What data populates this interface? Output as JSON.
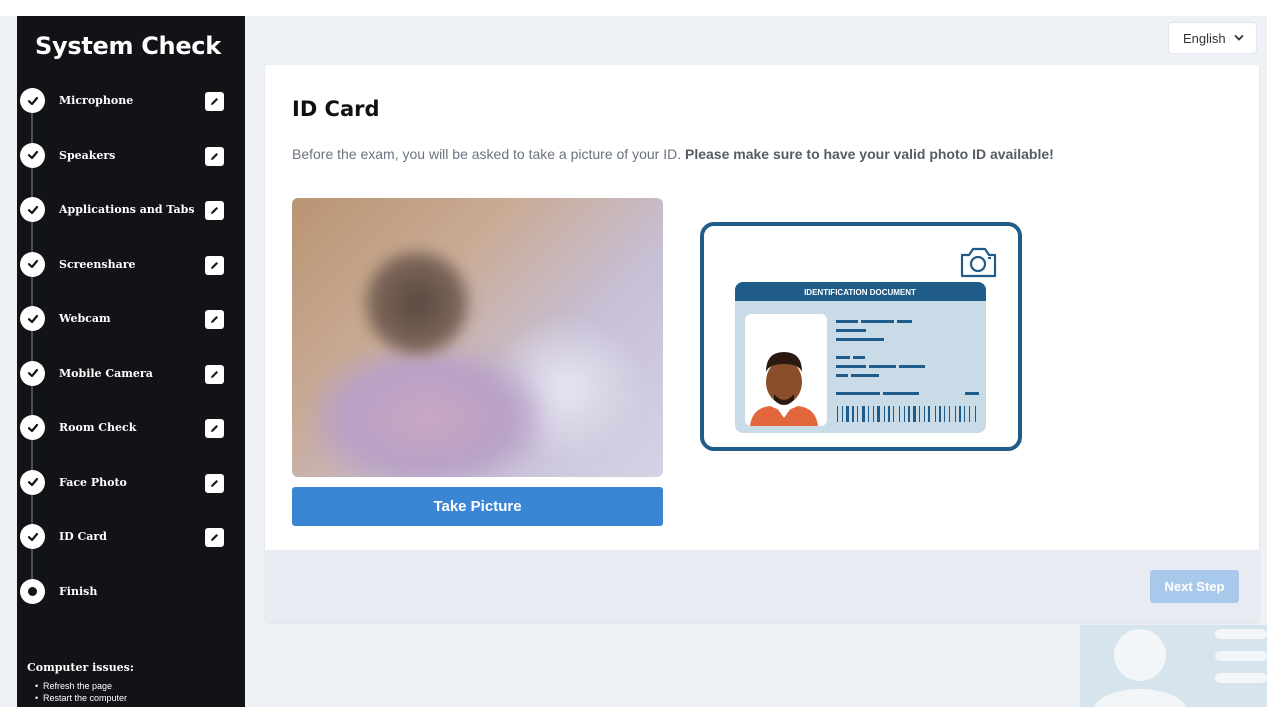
{
  "sidebar": {
    "title": "System Check",
    "steps": [
      {
        "label": "Microphone",
        "status": "done"
      },
      {
        "label": "Speakers",
        "status": "done"
      },
      {
        "label": "Applications and Tabs",
        "status": "done"
      },
      {
        "label": "Screenshare",
        "status": "done"
      },
      {
        "label": "Webcam",
        "status": "done"
      },
      {
        "label": "Mobile Camera",
        "status": "done"
      },
      {
        "label": "Room Check",
        "status": "done"
      },
      {
        "label": "Face Photo",
        "status": "done"
      },
      {
        "label": "ID Card",
        "status": "done"
      },
      {
        "label": "Finish",
        "status": "current"
      }
    ],
    "issues": {
      "title": "Computer issues:",
      "items": [
        "Refresh the page",
        "Restart the computer"
      ]
    }
  },
  "language": {
    "selected": "English"
  },
  "main": {
    "title": "ID Card",
    "description_plain": "Before the exam, you will be asked to take a picture of your ID. ",
    "description_bold": "Please make sure to have your valid photo ID available!",
    "take_picture_label": "Take Picture",
    "id_card_header": "IDENTIFICATION DOCUMENT",
    "next_step_label": "Next Step"
  },
  "colors": {
    "sidebar_bg": "#111317",
    "primary_button": "#3b86d4",
    "disabled_button": "#a9c9ec",
    "id_frame": "#1f5c8a"
  }
}
